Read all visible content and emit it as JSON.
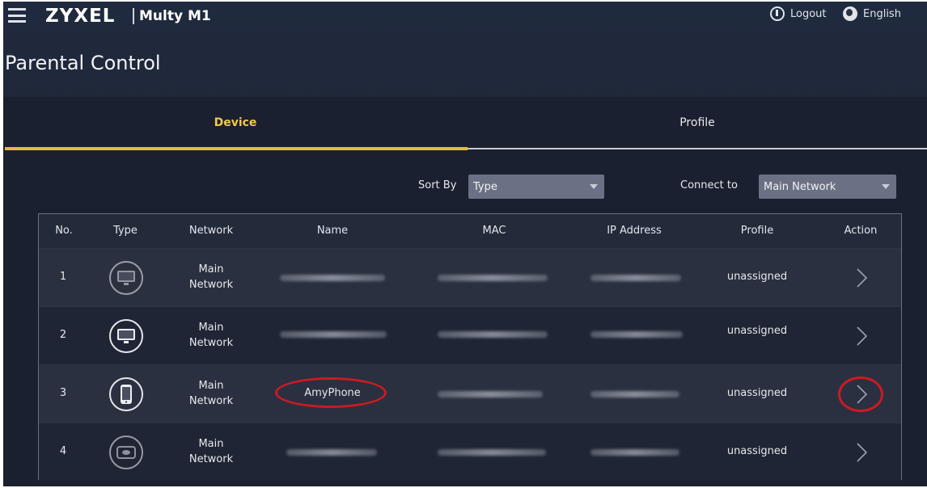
{
  "header": {
    "brand": "ZYXEL",
    "model": "Multy M1",
    "logout_label": "Logout",
    "language_label": "English"
  },
  "page_title": "Parental Control",
  "tabs": [
    {
      "label": "Device",
      "active": true
    },
    {
      "label": "Profile",
      "active": false
    }
  ],
  "filters": {
    "sort_by_label": "Sort By",
    "sort_by_value": "Type",
    "connect_to_label": "Connect to",
    "connect_to_value": "Main Network"
  },
  "table": {
    "columns": [
      "No.",
      "Type",
      "Network",
      "Name",
      "MAC",
      "IP Address",
      "Profile",
      "Action"
    ],
    "rows": [
      {
        "no": "1",
        "type_icon": "monitor-icon",
        "network_line1": "Main",
        "network_line2": "Network",
        "name": "",
        "profile": "unassigned"
      },
      {
        "no": "2",
        "type_icon": "monitor-icon",
        "network_line1": "Main",
        "network_line2": "Network",
        "name": "",
        "profile": "unassigned"
      },
      {
        "no": "3",
        "type_icon": "phone-icon",
        "network_line1": "Main",
        "network_line2": "Network",
        "name": "AmyPhone",
        "profile": "unassigned"
      },
      {
        "no": "4",
        "type_icon": "device-icon",
        "network_line1": "Main",
        "network_line2": "Network",
        "name": "",
        "profile": "unassigned"
      }
    ]
  },
  "colors": {
    "accent": "#e8b93e",
    "background": "#1f2638",
    "highlight": "#cc1a22"
  }
}
